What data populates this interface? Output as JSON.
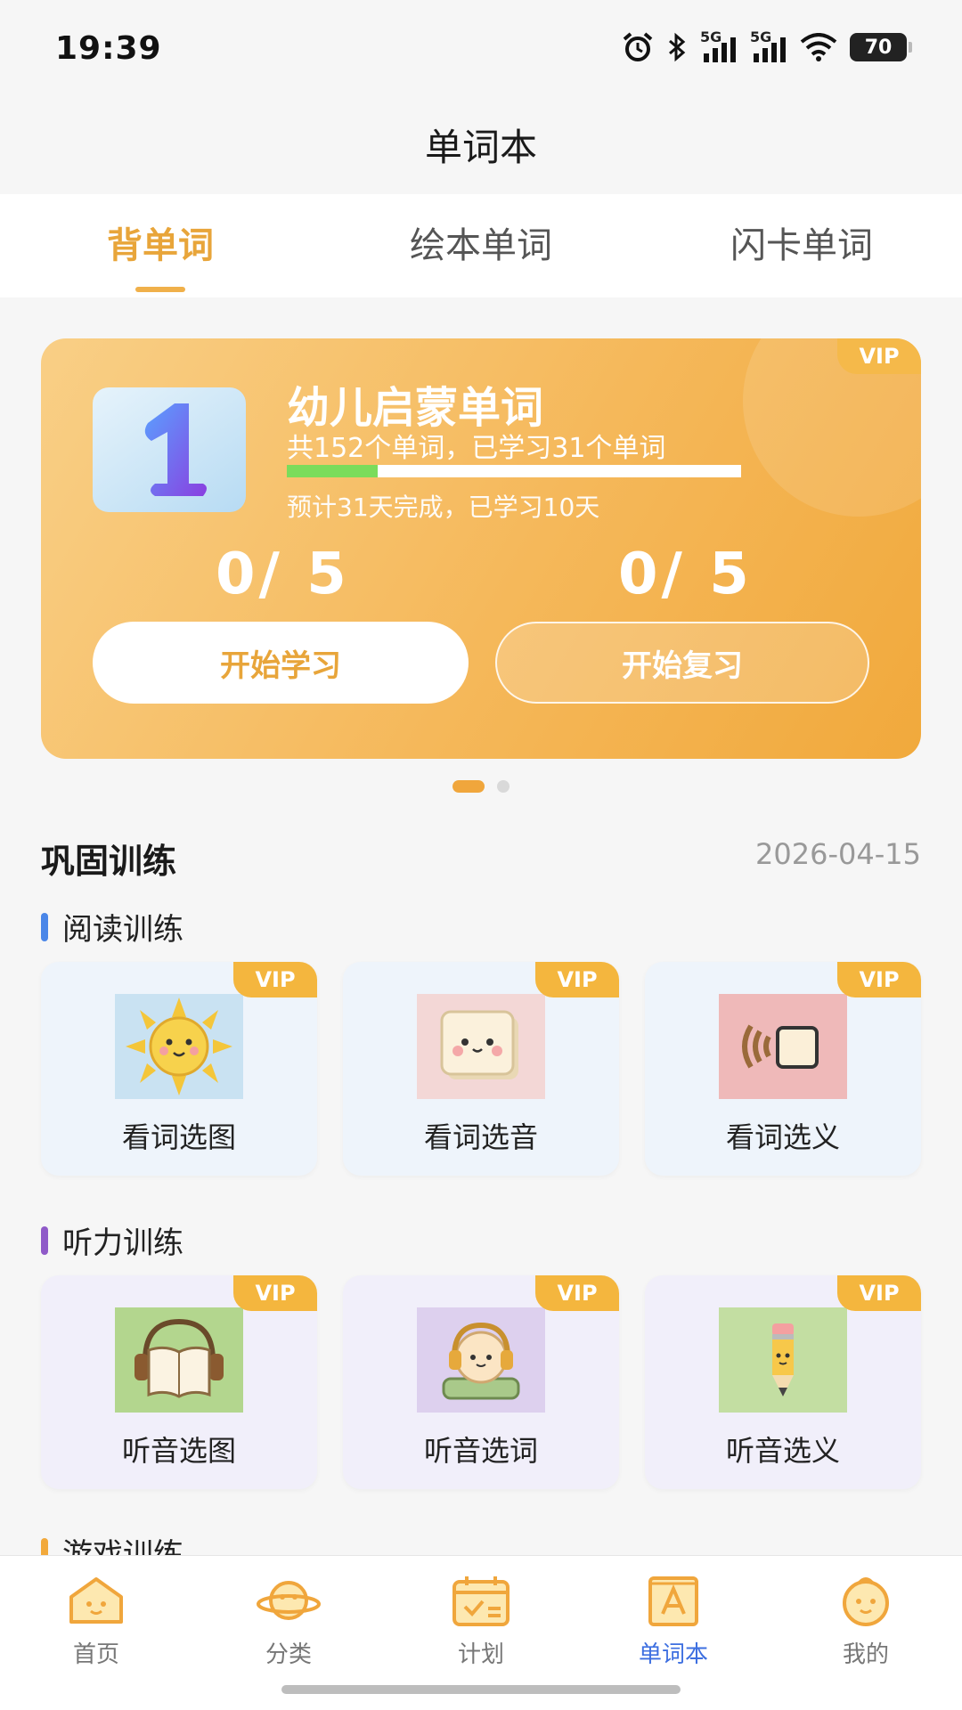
{
  "status_bar": {
    "time": "19:39",
    "network1": "5G",
    "network2": "5G",
    "battery": "70"
  },
  "page_title": "单词本",
  "tabs": [
    {
      "label": "背单词",
      "active": true
    },
    {
      "label": "绘本单词",
      "active": false
    },
    {
      "label": "闪卡单词",
      "active": false
    }
  ],
  "banner": {
    "vip": "VIP",
    "tile_number": "1",
    "title": "幼儿启蒙单词",
    "subtitle": "共152个单词，已学习31个单词",
    "progress_fraction": 0.2,
    "estimate": "预计31天完成，已学习10天",
    "learn_count": "0/ 5",
    "review_count": "0/ 5",
    "learn_button": "开始学习",
    "review_button": "开始复习"
  },
  "pager": {
    "pages": 2,
    "active": 0
  },
  "training": {
    "title": "巩固训练",
    "date": "2026-04-15",
    "reading": {
      "title": "阅读训练",
      "color": "#4a86e8",
      "cards": [
        {
          "label": "看词选图",
          "vip": "VIP",
          "icon": "sun-icon"
        },
        {
          "label": "看词选音",
          "vip": "VIP",
          "icon": "tofu-icon"
        },
        {
          "label": "看词选义",
          "vip": "VIP",
          "icon": "sound-block-icon"
        }
      ]
    },
    "listening": {
      "title": "听力训练",
      "color": "#8f5ac8",
      "cards": [
        {
          "label": "听音选图",
          "vip": "VIP",
          "icon": "book-headphones-icon"
        },
        {
          "label": "听音选词",
          "vip": "VIP",
          "icon": "bun-headphones-icon"
        },
        {
          "label": "听音选义",
          "vip": "VIP",
          "icon": "pencil-icon"
        }
      ]
    },
    "game": {
      "title": "游戏训练",
      "color": "#f2a93b"
    }
  },
  "bottom_nav": [
    {
      "label": "首页",
      "icon": "home-icon",
      "active": false
    },
    {
      "label": "分类",
      "icon": "planet-icon",
      "active": false
    },
    {
      "label": "计划",
      "icon": "calendar-icon",
      "active": false
    },
    {
      "label": "单词本",
      "icon": "wordbook-icon",
      "active": true
    },
    {
      "label": "我的",
      "icon": "profile-icon",
      "active": false
    }
  ],
  "colors": {
    "accent": "#f0a63c",
    "nav_active": "#3d6fe0",
    "progress": "#7bdc5b"
  }
}
